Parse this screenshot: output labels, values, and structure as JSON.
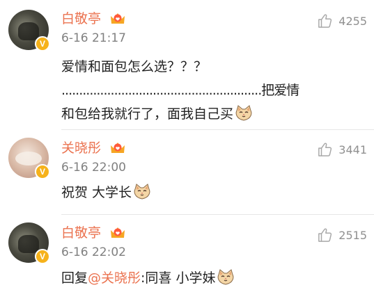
{
  "colors": {
    "username": "#eb7350",
    "timestamp": "#808080",
    "like_count": "#909090",
    "badge": "#f6b21b"
  },
  "comments": [
    {
      "username": "白敬亭",
      "time": "6-16 21:17",
      "likes": "4255",
      "line1": "爱情和面包怎么选？？？",
      "line2": ".........................................................把爱情",
      "line3": "和包给我就行了，面我自己买",
      "avatar_icon": "avatar-dark",
      "badge_icon": "verified-v-icon",
      "vip_icon": "vip-crown-icon",
      "emoji_icon": "cat-face-emoji"
    },
    {
      "username": "关晓彤",
      "time": "6-16 22:00",
      "likes": "3441",
      "line1": "祝贺 大学长",
      "avatar_icon": "avatar-light",
      "badge_icon": "verified-v-icon",
      "vip_icon": "vip-crown-icon",
      "emoji_icon": "cat-face-emoji"
    },
    {
      "username": "白敬亭",
      "time": "6-16 22:02",
      "likes": "2515",
      "reply_prefix": "回复",
      "mention": "@关晓彤",
      "reply_text": ":同喜 小学妹",
      "avatar_icon": "avatar-dark",
      "badge_icon": "verified-v-icon",
      "vip_icon": "vip-crown-icon",
      "emoji_icon": "cat-face-emoji"
    }
  ],
  "badge_letter": "V"
}
